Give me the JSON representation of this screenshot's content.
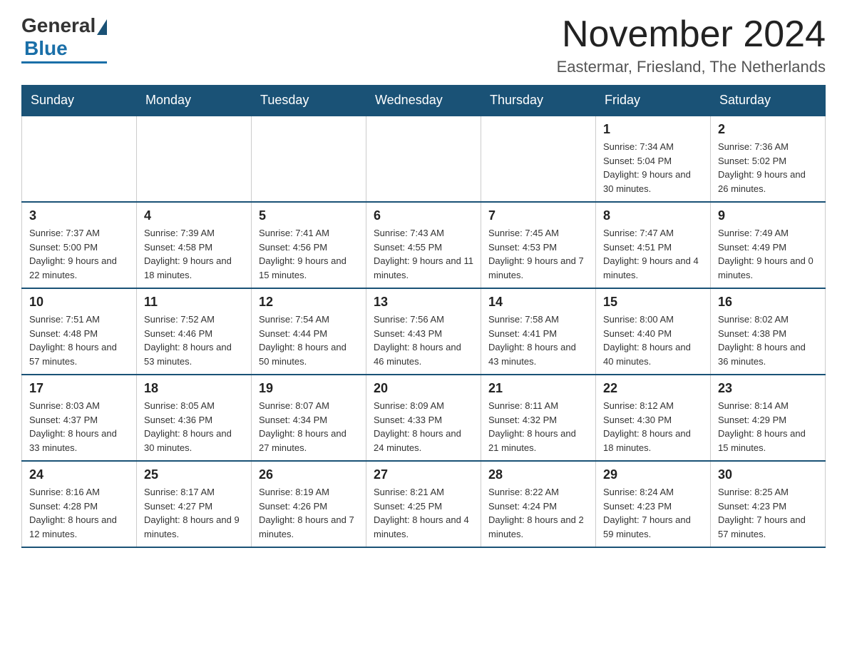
{
  "logo": {
    "general": "General",
    "blue": "Blue"
  },
  "header": {
    "title": "November 2024",
    "subtitle": "Eastermar, Friesland, The Netherlands"
  },
  "days_of_week": [
    "Sunday",
    "Monday",
    "Tuesday",
    "Wednesday",
    "Thursday",
    "Friday",
    "Saturday"
  ],
  "weeks": [
    [
      {
        "day": "",
        "info": ""
      },
      {
        "day": "",
        "info": ""
      },
      {
        "day": "",
        "info": ""
      },
      {
        "day": "",
        "info": ""
      },
      {
        "day": "",
        "info": ""
      },
      {
        "day": "1",
        "info": "Sunrise: 7:34 AM\nSunset: 5:04 PM\nDaylight: 9 hours and 30 minutes."
      },
      {
        "day": "2",
        "info": "Sunrise: 7:36 AM\nSunset: 5:02 PM\nDaylight: 9 hours and 26 minutes."
      }
    ],
    [
      {
        "day": "3",
        "info": "Sunrise: 7:37 AM\nSunset: 5:00 PM\nDaylight: 9 hours and 22 minutes."
      },
      {
        "day": "4",
        "info": "Sunrise: 7:39 AM\nSunset: 4:58 PM\nDaylight: 9 hours and 18 minutes."
      },
      {
        "day": "5",
        "info": "Sunrise: 7:41 AM\nSunset: 4:56 PM\nDaylight: 9 hours and 15 minutes."
      },
      {
        "day": "6",
        "info": "Sunrise: 7:43 AM\nSunset: 4:55 PM\nDaylight: 9 hours and 11 minutes."
      },
      {
        "day": "7",
        "info": "Sunrise: 7:45 AM\nSunset: 4:53 PM\nDaylight: 9 hours and 7 minutes."
      },
      {
        "day": "8",
        "info": "Sunrise: 7:47 AM\nSunset: 4:51 PM\nDaylight: 9 hours and 4 minutes."
      },
      {
        "day": "9",
        "info": "Sunrise: 7:49 AM\nSunset: 4:49 PM\nDaylight: 9 hours and 0 minutes."
      }
    ],
    [
      {
        "day": "10",
        "info": "Sunrise: 7:51 AM\nSunset: 4:48 PM\nDaylight: 8 hours and 57 minutes."
      },
      {
        "day": "11",
        "info": "Sunrise: 7:52 AM\nSunset: 4:46 PM\nDaylight: 8 hours and 53 minutes."
      },
      {
        "day": "12",
        "info": "Sunrise: 7:54 AM\nSunset: 4:44 PM\nDaylight: 8 hours and 50 minutes."
      },
      {
        "day": "13",
        "info": "Sunrise: 7:56 AM\nSunset: 4:43 PM\nDaylight: 8 hours and 46 minutes."
      },
      {
        "day": "14",
        "info": "Sunrise: 7:58 AM\nSunset: 4:41 PM\nDaylight: 8 hours and 43 minutes."
      },
      {
        "day": "15",
        "info": "Sunrise: 8:00 AM\nSunset: 4:40 PM\nDaylight: 8 hours and 40 minutes."
      },
      {
        "day": "16",
        "info": "Sunrise: 8:02 AM\nSunset: 4:38 PM\nDaylight: 8 hours and 36 minutes."
      }
    ],
    [
      {
        "day": "17",
        "info": "Sunrise: 8:03 AM\nSunset: 4:37 PM\nDaylight: 8 hours and 33 minutes."
      },
      {
        "day": "18",
        "info": "Sunrise: 8:05 AM\nSunset: 4:36 PM\nDaylight: 8 hours and 30 minutes."
      },
      {
        "day": "19",
        "info": "Sunrise: 8:07 AM\nSunset: 4:34 PM\nDaylight: 8 hours and 27 minutes."
      },
      {
        "day": "20",
        "info": "Sunrise: 8:09 AM\nSunset: 4:33 PM\nDaylight: 8 hours and 24 minutes."
      },
      {
        "day": "21",
        "info": "Sunrise: 8:11 AM\nSunset: 4:32 PM\nDaylight: 8 hours and 21 minutes."
      },
      {
        "day": "22",
        "info": "Sunrise: 8:12 AM\nSunset: 4:30 PM\nDaylight: 8 hours and 18 minutes."
      },
      {
        "day": "23",
        "info": "Sunrise: 8:14 AM\nSunset: 4:29 PM\nDaylight: 8 hours and 15 minutes."
      }
    ],
    [
      {
        "day": "24",
        "info": "Sunrise: 8:16 AM\nSunset: 4:28 PM\nDaylight: 8 hours and 12 minutes."
      },
      {
        "day": "25",
        "info": "Sunrise: 8:17 AM\nSunset: 4:27 PM\nDaylight: 8 hours and 9 minutes."
      },
      {
        "day": "26",
        "info": "Sunrise: 8:19 AM\nSunset: 4:26 PM\nDaylight: 8 hours and 7 minutes."
      },
      {
        "day": "27",
        "info": "Sunrise: 8:21 AM\nSunset: 4:25 PM\nDaylight: 8 hours and 4 minutes."
      },
      {
        "day": "28",
        "info": "Sunrise: 8:22 AM\nSunset: 4:24 PM\nDaylight: 8 hours and 2 minutes."
      },
      {
        "day": "29",
        "info": "Sunrise: 8:24 AM\nSunset: 4:23 PM\nDaylight: 7 hours and 59 minutes."
      },
      {
        "day": "30",
        "info": "Sunrise: 8:25 AM\nSunset: 4:23 PM\nDaylight: 7 hours and 57 minutes."
      }
    ]
  ]
}
